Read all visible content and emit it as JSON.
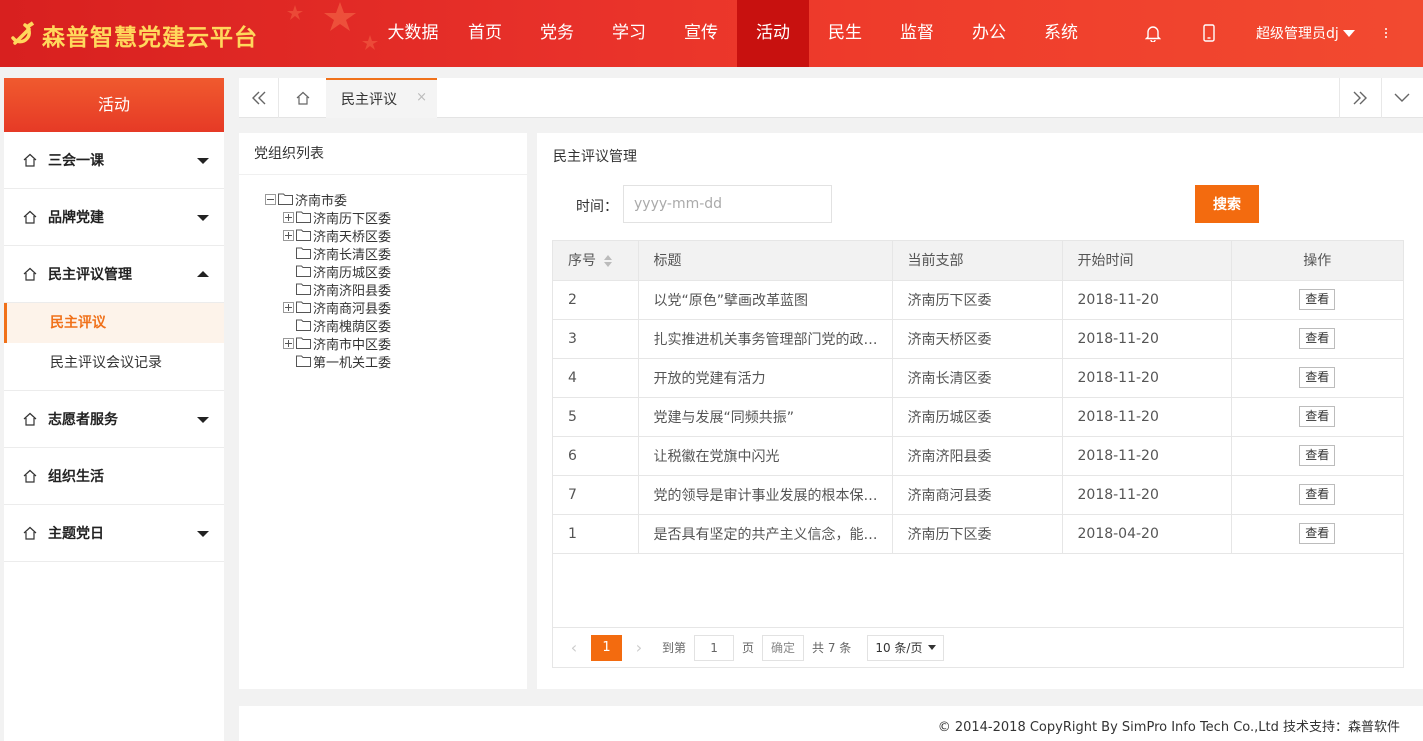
{
  "header": {
    "logo_text": "森普智慧党建云平台",
    "nav": [
      "大数据",
      "首页",
      "党务",
      "学习",
      "宣传",
      "活动",
      "民生",
      "监督",
      "办公",
      "系统"
    ],
    "active_nav": "活动",
    "user_name": "超级管理员dj",
    "icons": [
      "bell-icon",
      "mobile-icon",
      "more-icon"
    ]
  },
  "sidebar": {
    "title": "活动",
    "groups": [
      {
        "label": "三会一课",
        "state": "collapsed"
      },
      {
        "label": "品牌党建",
        "state": "collapsed"
      },
      {
        "label": "民主评议管理",
        "state": "expanded",
        "items": [
          "民主评议",
          "民主评议会议记录"
        ],
        "active_item": "民主评议"
      },
      {
        "label": "志愿者服务",
        "state": "collapsed"
      },
      {
        "label": "组织生活",
        "state": "none"
      },
      {
        "label": "主题党日",
        "state": "collapsed"
      }
    ]
  },
  "tabs": {
    "items": [
      {
        "label": "民主评议",
        "close": "×"
      }
    ]
  },
  "tree_panel": {
    "title": "党组织列表",
    "root": "济南市委",
    "children": [
      {
        "label": "济南历下区委",
        "expandable": true
      },
      {
        "label": "济南天桥区委",
        "expandable": true
      },
      {
        "label": "济南长清区委",
        "expandable": false
      },
      {
        "label": "济南历城区委",
        "expandable": false
      },
      {
        "label": "济南济阳县委",
        "expandable": false
      },
      {
        "label": "济南商河县委",
        "expandable": true
      },
      {
        "label": "济南槐荫区委",
        "expandable": false
      },
      {
        "label": "济南市中区委",
        "expandable": true
      },
      {
        "label": "第一机关工委",
        "expandable": false
      }
    ]
  },
  "content": {
    "title": "民主评议管理",
    "search": {
      "label": "时间：",
      "placeholder": "yyyy-mm-dd",
      "button": "搜索"
    },
    "table": {
      "columns": [
        "序号",
        "标题",
        "当前支部",
        "开始时间",
        "操作"
      ],
      "rows": [
        [
          "2",
          "以党“原色”擘画改革蓝图",
          "济南历下区委",
          "2018-11-20",
          "查看"
        ],
        [
          "3",
          "扎实推进机关事务管理部门党的政…",
          "济南天桥区委",
          "2018-11-20",
          "查看"
        ],
        [
          "4",
          "开放的党建有活力",
          "济南长清区委",
          "2018-11-20",
          "查看"
        ],
        [
          "5",
          "党建与发展“同频共振”",
          "济南历城区委",
          "2018-11-20",
          "查看"
        ],
        [
          "6",
          "让税徽在党旗中闪光",
          "济南济阳县委",
          "2018-11-20",
          "查看"
        ],
        [
          "7",
          "党的领导是审计事业发展的根本保…",
          "济南商河县委",
          "2018-11-20",
          "查看"
        ],
        [
          "1",
          "是否具有坚定的共产主义信念，能…",
          "济南历下区委",
          "2018-04-20",
          "查看"
        ]
      ]
    },
    "pager": {
      "current": "1",
      "goto_label": "到第",
      "goto_value": "1",
      "page_label": "页",
      "confirm": "确定",
      "total": "共 7 条",
      "page_size": "10 条/页"
    }
  },
  "footer": {
    "text": "© 2014-2018 CopyRight By SimPro Info Tech Co.,Ltd 技术支持：森普软件"
  },
  "colors": {
    "header_red": "#e8312a",
    "accent_orange": "#f36b0f",
    "active_nav": "#c8110f",
    "logo_gold": "#ffd85c"
  }
}
